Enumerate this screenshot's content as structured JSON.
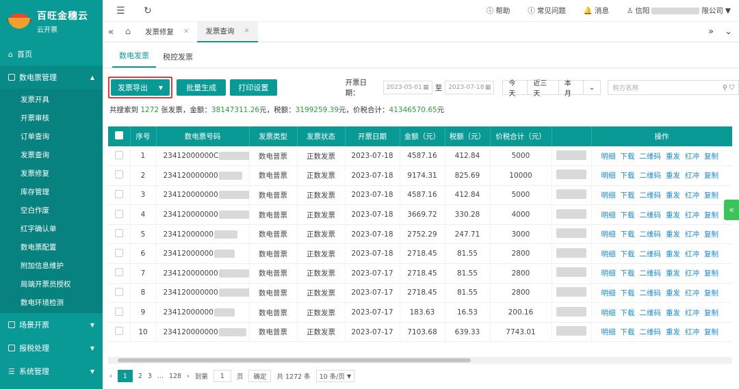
{
  "brand": {
    "name": "百旺金穗云",
    "sub": "云开票"
  },
  "sidebar": {
    "home": "首页",
    "groups": [
      {
        "label": "数电票管理",
        "open": true
      },
      {
        "label": "场景开票"
      },
      {
        "label": "报税处理"
      },
      {
        "label": "系统管理"
      }
    ],
    "sub_items": [
      "发票开具",
      "开票审核",
      "订单查询",
      "发票查询",
      "发票修复",
      "库存管理",
      "空白作废",
      "红字确认单",
      "数电票配置",
      "附加信息维护",
      "局端开票员授权",
      "数电环境检测"
    ]
  },
  "header": {
    "help": "帮助",
    "faq": "常见问题",
    "messages": "消息",
    "user_prefix": "信阳",
    "user_suffix": "限公司"
  },
  "tabs": [
    "发票修复",
    "发票查询"
  ],
  "subtabs": [
    "数电发票",
    "税控发票"
  ],
  "toolbar": {
    "export": "发票导出",
    "batch": "批量生成",
    "print": "打印设置",
    "date_label": "开票日期：",
    "date_from": "2023-05-01",
    "date_to_sep": "至",
    "date_to": "2023-07-18",
    "quick": [
      "今天",
      "近三天",
      "本月"
    ],
    "search_placeholder": "购方名称"
  },
  "summary": {
    "p1": "共搜索到 ",
    "count": "1272",
    "p2": " 张发票，金额：",
    "amount": "38147311.26",
    "p3": "元，税额：",
    "tax": "3199259.39",
    "p4": "元，价税合计：",
    "total": "41346570.65",
    "p5": "元"
  },
  "table": {
    "columns": [
      "序号",
      "数电票号码",
      "发票类型",
      "发票状态",
      "开票日期",
      "金额（元）",
      "税额（元）",
      "价税合计（元）",
      "",
      "操作"
    ],
    "ops": [
      "明细",
      "下载",
      "二维码",
      "重发",
      "红冲",
      "复制"
    ],
    "rows": [
      {
        "no": "1",
        "code": "23412000000C",
        "type": "数电普票",
        "status": "正数发票",
        "date": "2023-07-18",
        "amount": "4587.16",
        "tax": "412.84",
        "total": "5000"
      },
      {
        "no": "2",
        "code": "234120000000",
        "type": "数电普票",
        "status": "正数发票",
        "date": "2023-07-18",
        "amount": "9174.31",
        "tax": "825.69",
        "total": "10000"
      },
      {
        "no": "3",
        "code": "234120000000",
        "type": "数电普票",
        "status": "正数发票",
        "date": "2023-07-18",
        "amount": "4587.16",
        "tax": "412.84",
        "total": "5000"
      },
      {
        "no": "4",
        "code": "234120000000",
        "type": "数电普票",
        "status": "正数发票",
        "date": "2023-07-18",
        "amount": "3669.72",
        "tax": "330.28",
        "total": "4000"
      },
      {
        "no": "5",
        "code": "23412000000",
        "type": "数电普票",
        "status": "正数发票",
        "date": "2023-07-18",
        "amount": "2752.29",
        "tax": "247.71",
        "total": "3000"
      },
      {
        "no": "6",
        "code": "23412000000",
        "type": "数电普票",
        "status": "正数发票",
        "date": "2023-07-18",
        "amount": "2718.45",
        "tax": "81.55",
        "total": "2800"
      },
      {
        "no": "7",
        "code": "234120000000",
        "type": "数电普票",
        "status": "正数发票",
        "date": "2023-07-17",
        "amount": "2718.45",
        "tax": "81.55",
        "total": "2800"
      },
      {
        "no": "8",
        "code": "234120000000",
        "type": "数电普票",
        "status": "正数发票",
        "date": "2023-07-17",
        "amount": "2718.45",
        "tax": "81.55",
        "total": "2800"
      },
      {
        "no": "9",
        "code": "23412000000",
        "type": "数电普票",
        "status": "正数发票",
        "date": "2023-07-17",
        "amount": "183.63",
        "tax": "16.53",
        "total": "200.16"
      },
      {
        "no": "10",
        "code": "234120000000",
        "type": "数电普票",
        "status": "正数发票",
        "date": "2023-07-17",
        "amount": "7103.68",
        "tax": "639.33",
        "total": "7743.01"
      }
    ]
  },
  "pager": {
    "current": "1",
    "p2": "2",
    "p3": "3",
    "ellipsis": "...",
    "last": "128",
    "goto": "到第",
    "page_input": "1",
    "page_unit": "页",
    "confirm": "确定",
    "total": "共 1272 条",
    "size": "10 条/页"
  }
}
